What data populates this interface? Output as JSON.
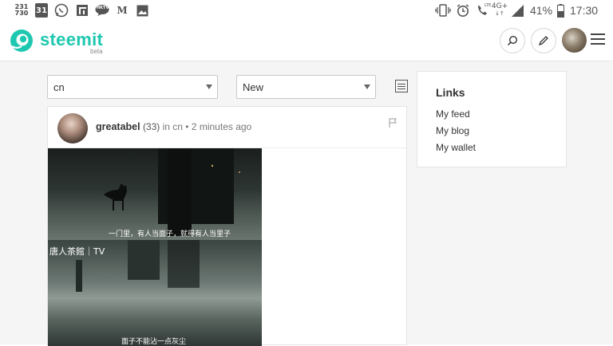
{
  "status_bar": {
    "notif_icons": [
      "news-230-730-icon",
      "calendar-31-icon",
      "whatsapp-icon",
      "app-icon",
      "hktv-icon",
      "medium-icon",
      "gallery-icon"
    ],
    "calendar_day": "31",
    "date_badge_top": "231",
    "date_badge_bottom": "730",
    "hktv_label": "HKTV",
    "medium_label": "M",
    "network_type": "4G+",
    "lte_label": "LTE",
    "battery_percent": "41%",
    "time": "17:30"
  },
  "header": {
    "logo_text": "steemit",
    "beta_label": "beta",
    "colors": {
      "brand": "#1ec8b0"
    }
  },
  "filters": {
    "tag_select": "cn",
    "sort_select": "New"
  },
  "post": {
    "author": "greatabel",
    "reputation": "(33)",
    "meta": "in cn • 2 minutes ago",
    "image_caption_1": "一门里，有人当面子，就得有人当里子",
    "image_watermark": "唐人茶館｜TV",
    "image_caption_2": "面子不能沾一点灰尘"
  },
  "sidebar": {
    "title": "Links",
    "links": [
      "My feed",
      "My blog",
      "My wallet"
    ]
  }
}
